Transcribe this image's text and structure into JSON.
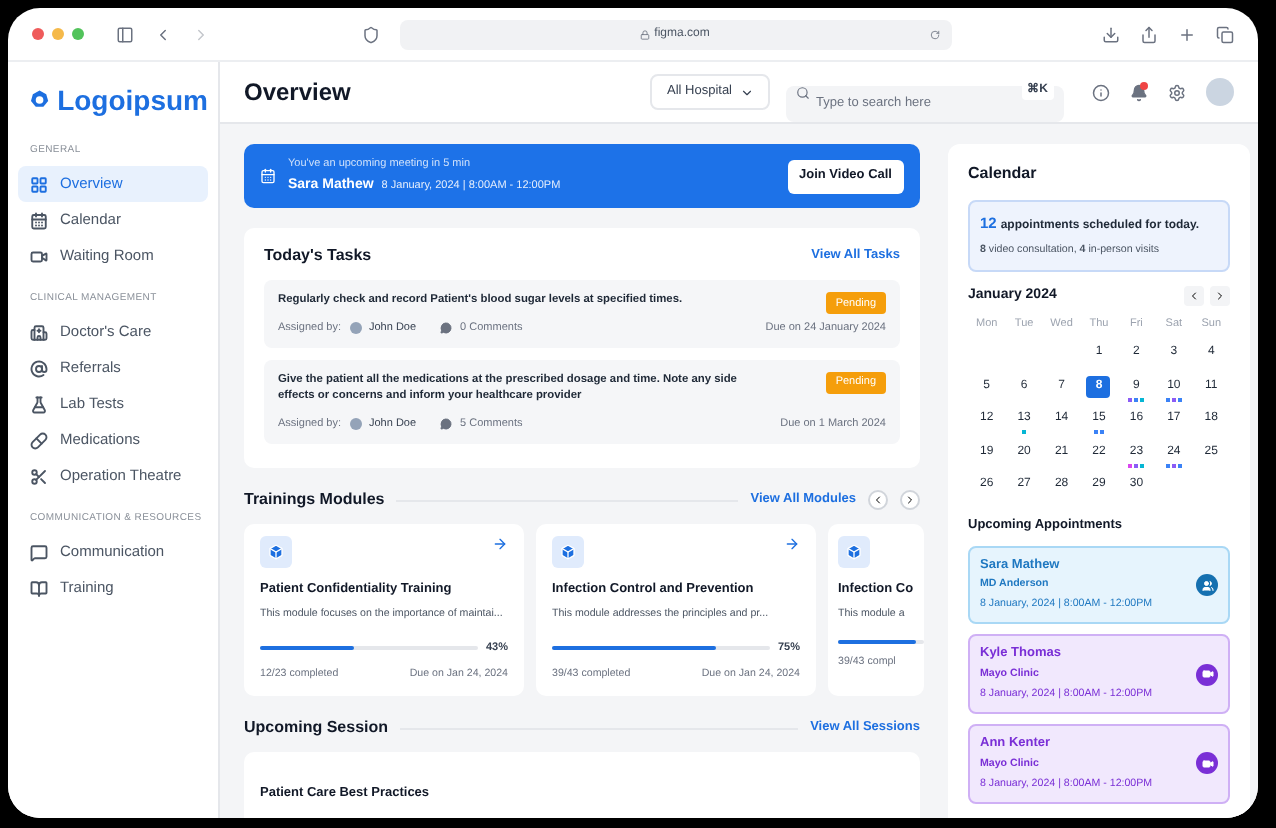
{
  "browser": {
    "url": "figma.com"
  },
  "brand": {
    "name": "Logoipsum"
  },
  "sidebar": {
    "sections": [
      {
        "title": "GENERAL",
        "items": [
          {
            "label": "Overview",
            "selected": true
          },
          {
            "label": "Calendar",
            "selected": false
          },
          {
            "label": "Waiting Room",
            "selected": false
          }
        ]
      },
      {
        "title": "CLINICAL MANAGEMENT",
        "items": [
          {
            "label": "Doctor's Care",
            "selected": false
          },
          {
            "label": "Referrals",
            "selected": false
          },
          {
            "label": "Lab Tests",
            "selected": false
          },
          {
            "label": "Medications",
            "selected": false
          },
          {
            "label": "Operation Theatre",
            "selected": false
          }
        ]
      },
      {
        "title": "COMMUNICATION & RESOURCES",
        "items": [
          {
            "label": "Communication",
            "selected": false
          },
          {
            "label": "Training",
            "selected": false
          }
        ]
      }
    ]
  },
  "header": {
    "title": "Overview",
    "hospital_select": "All Hospital",
    "search": {
      "placeholder": "Type to search here",
      "shortcut": "⌘K"
    },
    "notifications_unread": true
  },
  "banner": {
    "message": "You've an upcoming meeting in 5 min",
    "name": "Sara Mathew",
    "when": "8 January, 2024 | 8:00AM - 12:00PM",
    "button": "Join Video Call"
  },
  "tasks": {
    "title": "Today's Tasks",
    "link": "View All Tasks",
    "items": [
      {
        "text": "Regularly check and record Patient's blood sugar levels at specified times.",
        "assigned_label": "Assigned by:",
        "assignee": "John Doe",
        "comments": "0 Comments",
        "status": "Pending",
        "due": "Due on 24 January 2024"
      },
      {
        "text": "Give the patient all the medications at the prescribed dosage and time. Note any side effects or concerns and inform your healthcare provider",
        "assigned_label": "Assigned by:",
        "assignee": "John Doe",
        "comments": "5 Comments",
        "status": "Pending",
        "due": "Due on 1 March 2024"
      }
    ]
  },
  "trainings": {
    "title": "Trainings Modules",
    "link": "View All Modules",
    "modules": [
      {
        "title": "Patient Confidentiality Training",
        "description": "This module focuses on the importance of maintai...",
        "level": 0.43,
        "percent": "43%",
        "completed": "12/23 completed",
        "due": "Due on Jan 24, 2024"
      },
      {
        "title": "Infection Control and Prevention",
        "description": "This module addresses the principles and pr...",
        "level": 0.75,
        "percent": "75%",
        "completed": "39/43 completed",
        "due": "Due on Jan 24, 2024"
      },
      {
        "title": "Infection Co",
        "description": "This module a",
        "level": 0.9,
        "completed": "39/43 compl"
      }
    ]
  },
  "sessions": {
    "title": "Upcoming Session",
    "link": "View All Sessions",
    "items": [
      {
        "title": "Patient Care Best Practices"
      }
    ]
  },
  "calendar": {
    "title": "Calendar",
    "summary_count": "12",
    "summary_text": "appointments scheduled for today.",
    "summary_detail": "**8** video consultation, **4** in-person visits",
    "month": "January 2024",
    "weekdays": [
      "Mon",
      "Tue",
      "Wed",
      "Thu",
      "Fri",
      "Sat",
      "Sun"
    ],
    "weeks": [
      [
        {
          "day": "1",
          "selected": false
        },
        {
          "day": "2",
          "selected": false
        },
        {
          "day": "3",
          "selected": false
        },
        {
          "day": "4",
          "selected": false
        }
      ],
      [
        {
          "day": "5",
          "selected": false
        },
        {
          "day": "6",
          "selected": false
        },
        {
          "day": "7",
          "selected": false
        },
        {
          "day": "8",
          "selected": true
        },
        {
          "day": "9",
          "selected": false,
          "dots": [
            {
              "color": "#8b5cf6"
            },
            {
              "color": "#3b82f6"
            },
            {
              "color": "#06b6d4"
            }
          ]
        },
        {
          "day": "10",
          "selected": false,
          "dots": [
            {
              "color": "#3b82f6"
            },
            {
              "color": "#8b5cf6"
            },
            {
              "color": "#3b82f6"
            }
          ]
        },
        {
          "day": "11",
          "selected": false
        }
      ],
      [
        {
          "day": "12",
          "selected": false
        },
        {
          "day": "13",
          "selected": false,
          "dots": [
            {
              "color": "#06b6d4"
            }
          ]
        },
        {
          "day": "14",
          "selected": false
        },
        {
          "day": "15",
          "selected": false,
          "dots": [
            {
              "color": "#3b82f6"
            },
            {
              "color": "#3b82f6"
            }
          ]
        },
        {
          "day": "16",
          "selected": false
        },
        {
          "day": "17",
          "selected": false
        },
        {
          "day": "18",
          "selected": false
        }
      ],
      [
        {
          "day": "19",
          "selected": false
        },
        {
          "day": "20",
          "selected": false
        },
        {
          "day": "21",
          "selected": false
        },
        {
          "day": "22",
          "selected": false
        },
        {
          "day": "23",
          "selected": false,
          "dots": [
            {
              "color": "#d946ef"
            },
            {
              "color": "#8b5cf6"
            },
            {
              "color": "#06b6d4"
            }
          ]
        },
        {
          "day": "24",
          "selected": false,
          "dots": [
            {
              "color": "#3b82f6"
            },
            {
              "color": "#8b5cf6"
            },
            {
              "color": "#3b82f6"
            }
          ]
        },
        {
          "day": "25",
          "selected": false
        }
      ],
      [
        {
          "day": "26",
          "selected": false
        },
        {
          "day": "27",
          "selected": false
        },
        {
          "day": "28",
          "selected": false
        },
        {
          "day": "29",
          "selected": false
        },
        {
          "day": "30",
          "selected": false
        }
      ]
    ]
  },
  "appointments": {
    "title": "Upcoming Appointments",
    "items": [
      {
        "kind": "in_person",
        "name": "Sara Mathew",
        "place": "MD Anderson",
        "when": "8 January, 2024 | 8:00AM - 12:00PM"
      },
      {
        "kind": "video",
        "name": "Kyle Thomas",
        "place": "Mayo Clinic",
        "when": "8 January, 2024 | 8:00AM - 12:00PM"
      },
      {
        "kind": "video",
        "name": "Ann Kenter",
        "place": "Mayo Clinic",
        "when": "8 January, 2024 | 8:00AM - 12:00PM"
      }
    ]
  }
}
